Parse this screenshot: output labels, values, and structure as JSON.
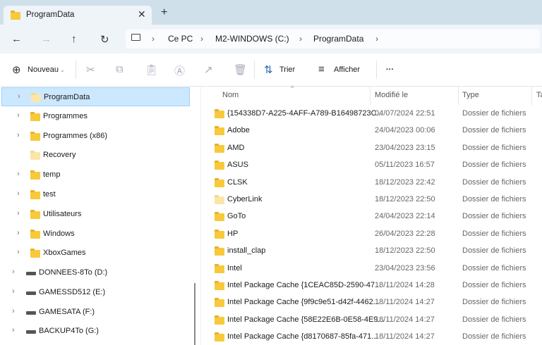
{
  "tab": {
    "title": "ProgramData",
    "close": "✕",
    "new": "+"
  },
  "nav_buttons": {
    "back": "←",
    "forward": "→",
    "up": "↑",
    "refresh": "↻"
  },
  "breadcrumb": [
    "Ce PC",
    "M2-WINDOWS (C:)",
    "ProgramData"
  ],
  "toolbar": {
    "new_label": "Nouveau",
    "sort_label": "Trier",
    "view_label": "Afficher",
    "more": "···"
  },
  "sidebar": {
    "folders": [
      {
        "label": "ProgramData",
        "selected": true,
        "expandable": true
      },
      {
        "label": "Programmes",
        "expandable": true
      },
      {
        "label": "Programmes (x86)",
        "expandable": true
      },
      {
        "label": "Recovery",
        "expandable": false,
        "hidden": true
      },
      {
        "label": "temp",
        "expandable": true
      },
      {
        "label": "test",
        "expandable": true
      },
      {
        "label": "Utilisateurs",
        "expandable": true
      },
      {
        "label": "Windows",
        "expandable": true
      },
      {
        "label": "XboxGames",
        "expandable": true
      }
    ],
    "drives": [
      {
        "label": "DONNEES-8To (D:)"
      },
      {
        "label": "GAMESSD512 (E:)"
      },
      {
        "label": "GAMESATA (F:)"
      },
      {
        "label": "BACKUP4To (G:)"
      }
    ]
  },
  "columns": {
    "name": "Nom",
    "modified": "Modifié le",
    "type": "Type",
    "size": "Ta"
  },
  "files": [
    {
      "name": "{154338D7-A225-4AFF-A789-B16498723C...",
      "modified": "04/07/2024 22:51",
      "type": "Dossier de fichiers"
    },
    {
      "name": "Adobe",
      "modified": "24/04/2023 00:06",
      "type": "Dossier de fichiers"
    },
    {
      "name": "AMD",
      "modified": "23/04/2023 23:15",
      "type": "Dossier de fichiers"
    },
    {
      "name": "ASUS",
      "modified": "05/11/2023 16:57",
      "type": "Dossier de fichiers"
    },
    {
      "name": "CLSK",
      "modified": "18/12/2023 22:42",
      "type": "Dossier de fichiers"
    },
    {
      "name": "CyberLink",
      "modified": "18/12/2023 22:50",
      "type": "Dossier de fichiers",
      "hidden": true
    },
    {
      "name": "GoTo",
      "modified": "24/04/2023 22:14",
      "type": "Dossier de fichiers"
    },
    {
      "name": "HP",
      "modified": "26/04/2023 22:28",
      "type": "Dossier de fichiers"
    },
    {
      "name": "install_clap",
      "modified": "18/12/2023 22:50",
      "type": "Dossier de fichiers"
    },
    {
      "name": "Intel",
      "modified": "23/04/2023 23:56",
      "type": "Dossier de fichiers"
    },
    {
      "name": "Intel Package Cache {1CEAC85D-2590-47...",
      "modified": "18/11/2024 14:28",
      "type": "Dossier de fichiers"
    },
    {
      "name": "Intel Package Cache {9f9c9e51-d42f-4462...",
      "modified": "18/11/2024 14:27",
      "type": "Dossier de fichiers"
    },
    {
      "name": "Intel Package Cache {58E22E6B-0E58-4E9...",
      "modified": "18/11/2024 14:27",
      "type": "Dossier de fichiers"
    },
    {
      "name": "Intel Package Cache {d8170687-85fa-471...",
      "modified": "18/11/2024 14:27",
      "type": "Dossier de fichiers"
    }
  ]
}
